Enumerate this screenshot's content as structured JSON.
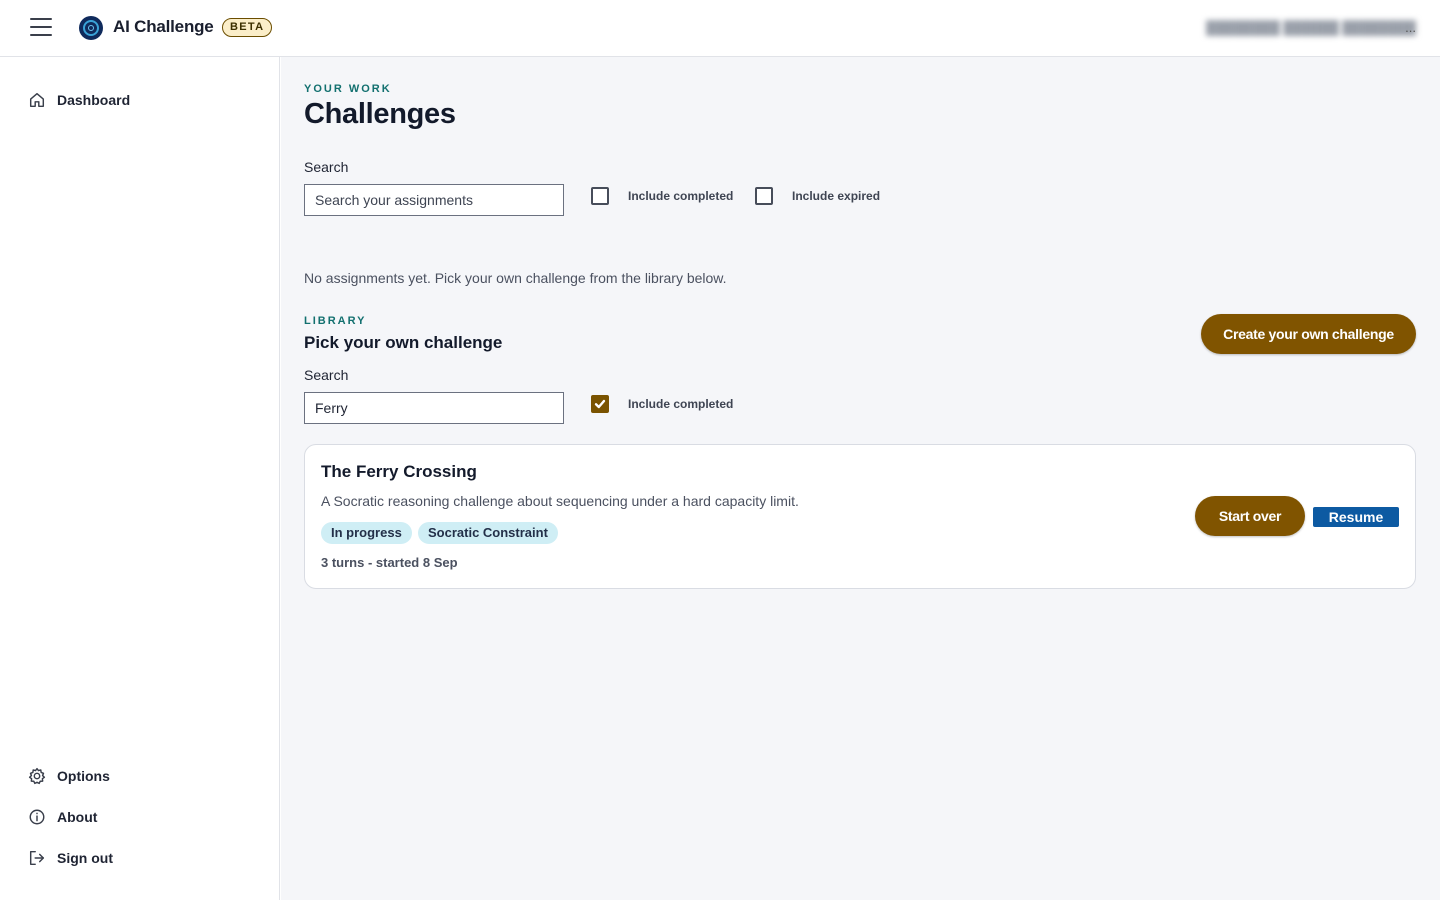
{
  "header": {
    "app_name": "AI Challenge",
    "badge": "BETA",
    "user_label": "████████ ██████ ████████",
    "user_ellipsis": "..."
  },
  "sidebar": {
    "top_items": [
      {
        "label": "Dashboard",
        "icon": "home-icon"
      }
    ],
    "bottom_items": [
      {
        "label": "Options",
        "icon": "gear-icon"
      },
      {
        "label": "About",
        "icon": "info-icon"
      },
      {
        "label": "Sign out",
        "icon": "sign-out-icon"
      }
    ]
  },
  "work": {
    "eyebrow": "YOUR WORK",
    "title": "Challenges",
    "search_label": "Search",
    "search_placeholder": "Search your assignments",
    "search_value": "",
    "include_completed": {
      "label": "Include completed",
      "checked": false
    },
    "include_expired": {
      "label": "Include expired",
      "checked": false
    },
    "empty_message": "No assignments yet. Pick your own challenge from the library below."
  },
  "library": {
    "eyebrow": "LIBRARY",
    "title": "Pick your own challenge",
    "create_button": "Create your own challenge",
    "search_label": "Search",
    "search_value": "Ferry",
    "include_completed": {
      "label": "Include completed",
      "checked": true
    }
  },
  "challenges": [
    {
      "title": "The Ferry Crossing",
      "description": "A Socratic reasoning challenge about sequencing under a hard capacity limit.",
      "tags": [
        "In progress",
        "Socratic Constraint"
      ],
      "meta": "3 turns - started 8 Sep",
      "start_over_label": "Start over",
      "resume_label": "Resume"
    }
  ],
  "colors": {
    "accent_teal": "#12706f",
    "button_brown": "#805400",
    "resume_blue": "#0d5aa2",
    "tag_bg": "#cfeef5"
  }
}
